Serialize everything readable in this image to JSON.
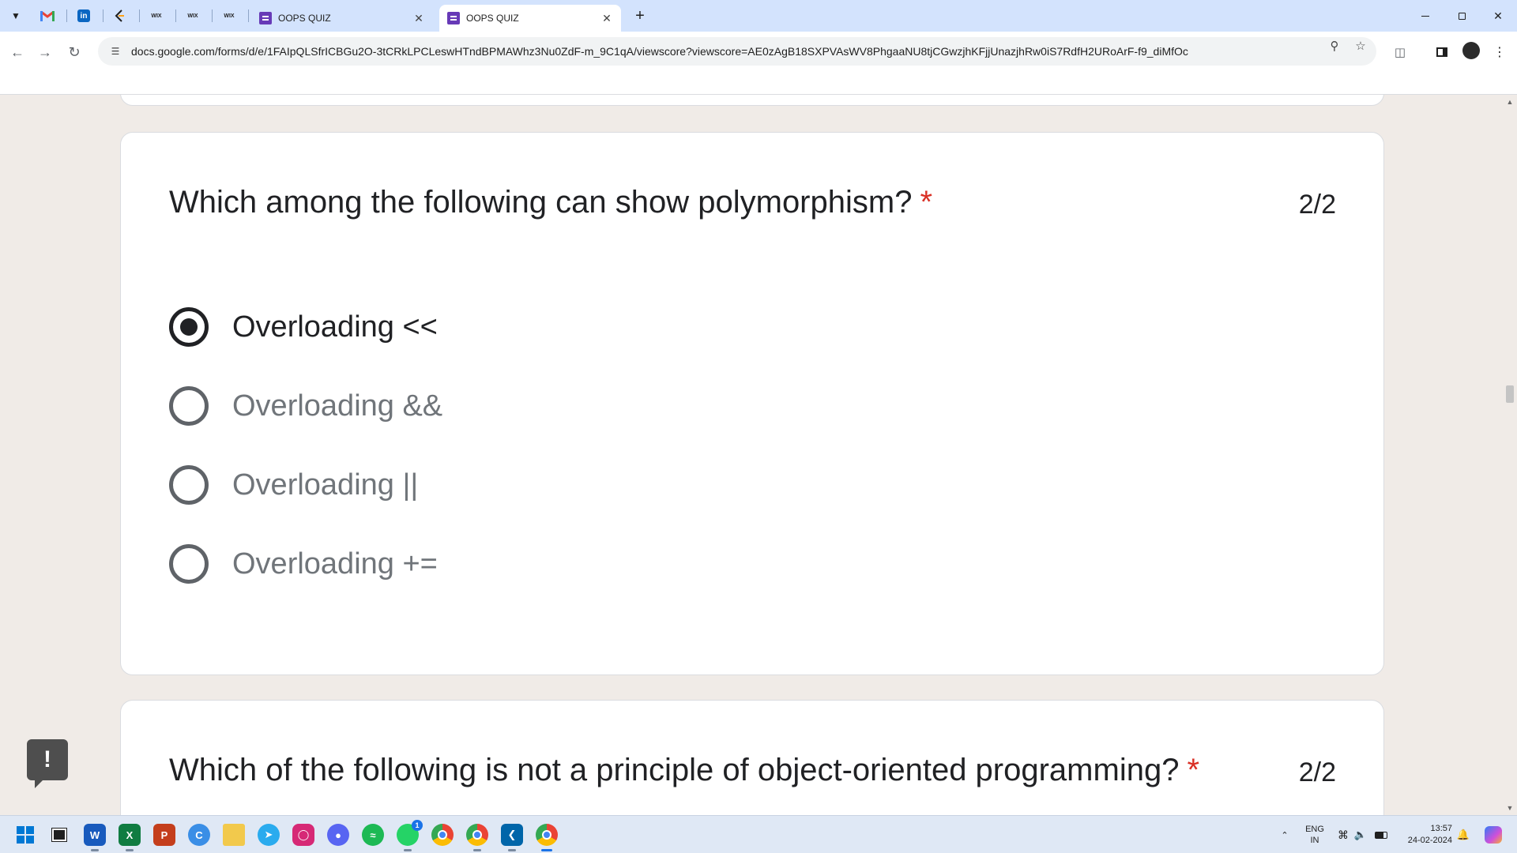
{
  "browser": {
    "tabs": [
      {
        "title": "OOPS QUIZ",
        "active": false
      },
      {
        "title": "OOPS QUIZ",
        "active": true
      }
    ],
    "pinned_labels": [
      "WIX",
      "WIX",
      "WIX"
    ],
    "new_tab_label": "+",
    "url": "docs.google.com/forms/d/e/1FAIpQLSfrICBGu2O-3tCRkLPCLeswHTndBPMAWhz3Nu0ZdF-m_9C1qA/viewscore?viewscore=AE0zAgB18SXPVAsWV8PhgaaNU8tjCGwzjhKFjjUnazjhRw0iS7RdfH2URoArF-f9_diMfOc"
  },
  "form": {
    "question1": {
      "title": "Which among the following can show polymorphism?",
      "required_mark": "*",
      "score": "2/2",
      "options": [
        {
          "label": "Overloading <<",
          "checked": true
        },
        {
          "label": "Overloading &&",
          "checked": false
        },
        {
          "label": "Overloading ||",
          "checked": false
        },
        {
          "label": "Overloading +=",
          "checked": false
        }
      ]
    },
    "question2": {
      "title": "Which of the following is not a principle of object-oriented programming?",
      "required_mark": "*",
      "score": "2/2"
    },
    "feedback_label": "!"
  },
  "taskbar": {
    "apps": [
      "windows-start",
      "file-explorer-window",
      "word",
      "excel",
      "powerpoint",
      "edge-c",
      "folder",
      "telegram",
      "instagram",
      "discord",
      "spotify",
      "whatsapp",
      "chrome",
      "chrome-profile",
      "vscode",
      "chrome-active"
    ],
    "whatsapp_badge": "1",
    "language": {
      "line1": "ENG",
      "line2": "IN"
    },
    "time": "13:57",
    "date": "24-02-2024"
  },
  "colors": {
    "tabstrip": "#d3e3fd",
    "page_bg": "#f0ebe7",
    "forms_purple": "#673ab7",
    "required_red": "#d93025"
  }
}
